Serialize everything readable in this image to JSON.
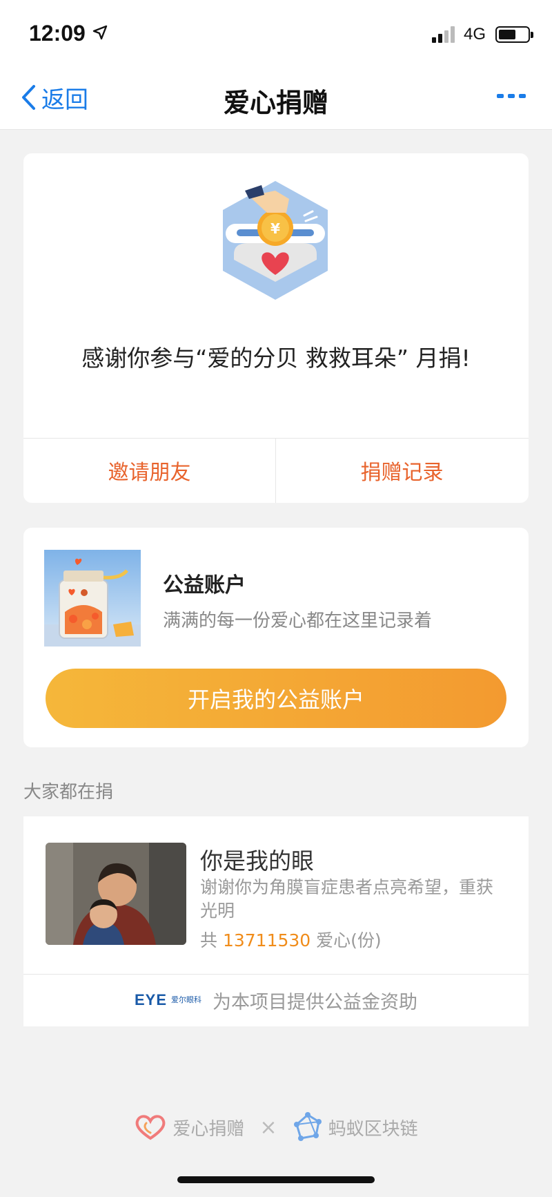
{
  "status": {
    "time": "12:09",
    "network": "4G",
    "location_icon": "location-arrow-icon"
  },
  "nav": {
    "back_label": "返回",
    "title": "爱心捐赠",
    "more_icon": "more-dots-icon"
  },
  "thanks_card": {
    "message": "感谢你参与“爱的分贝 救救耳朵” 月捐!",
    "actions": [
      "邀请朋友",
      "捐赠记录"
    ]
  },
  "account_card": {
    "title": "公益账户",
    "subtitle": "满满的每一份爱心都在这里记录着",
    "button": "开启我的公益账户"
  },
  "section_label": "大家都在捐",
  "project": {
    "title": "你是我的眼",
    "description": "谢谢你为角膜盲症患者点亮希望，重获光明",
    "count_prefix": "共",
    "count": "13711530",
    "count_suffix": "爱心(份)",
    "sponsor_logo_text": "EYE",
    "sponsor_logo_cn": "爱尔眼科",
    "sponsor_text": "为本项目提供公益金资助"
  },
  "footer": {
    "left": "爱心捐赠",
    "separator": "×",
    "right": "蚂蚁区块链"
  },
  "colors": {
    "accent_blue": "#1a7ce8",
    "accent_orange": "#e8632c",
    "button_gradient_start": "#f5b73a",
    "button_gradient_end": "#f39a30",
    "count_orange": "#f08c1a"
  }
}
